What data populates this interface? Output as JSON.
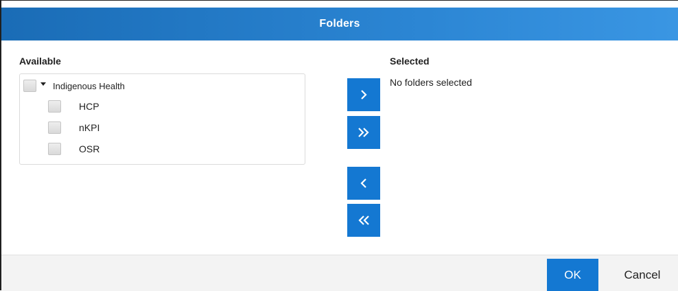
{
  "dialog": {
    "title": "Folders",
    "available_label": "Available",
    "selected_label": "Selected",
    "selected_empty_text": "No folders selected"
  },
  "tree": {
    "root": {
      "label": "Indigenous Health",
      "expanded": true,
      "checked": false
    },
    "children": [
      {
        "label": "HCP",
        "checked": false
      },
      {
        "label": "nKPI",
        "checked": false
      },
      {
        "label": "OSR",
        "checked": false
      }
    ]
  },
  "transfer_buttons": {
    "move_selected_icon": "chevron-right-icon",
    "move_all_icon": "double-chevron-right-icon",
    "remove_selected_icon": "chevron-left-icon",
    "remove_all_icon": "double-chevron-left-icon"
  },
  "footer": {
    "ok_label": "OK",
    "cancel_label": "Cancel"
  },
  "colors": {
    "title_bar": "#1a6cb6",
    "accent": "#1478d2",
    "footer_bg": "#f3f3f3"
  }
}
